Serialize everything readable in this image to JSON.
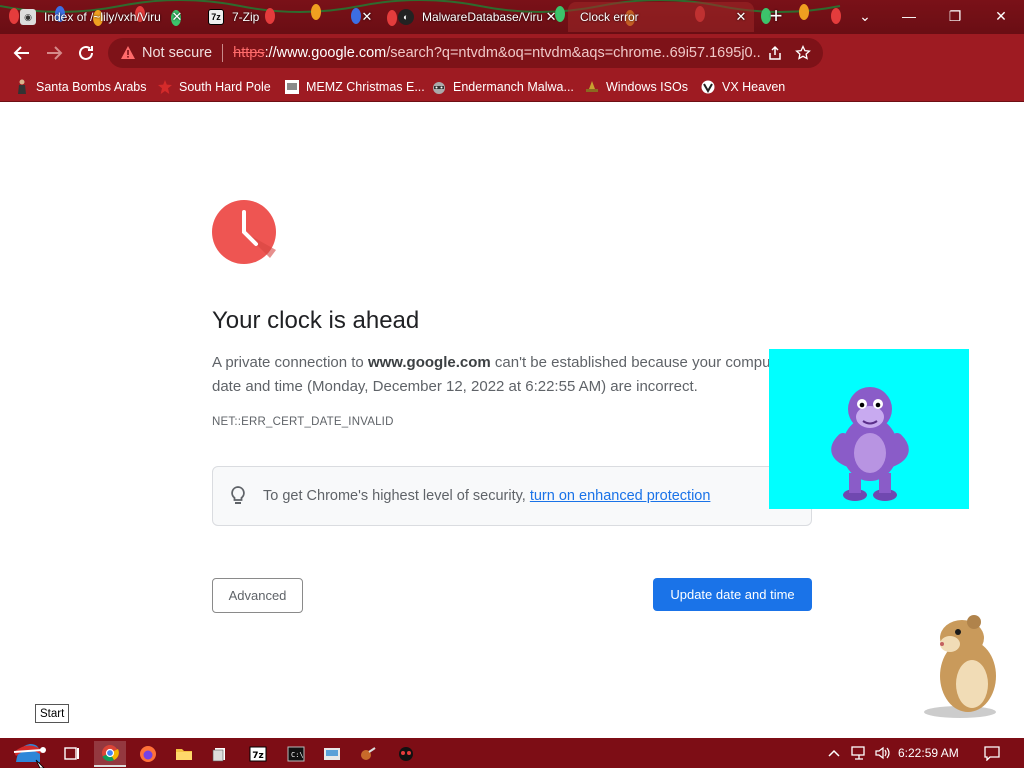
{
  "browser": {
    "tabs": [
      {
        "title": "Index of /~lily/vxh/Viru",
        "favicon": "web-icon"
      },
      {
        "title": "7-Zip",
        "favicon": "7zip-icon"
      },
      {
        "title": "MalwareDatabase/Viru",
        "favicon": "github-icon"
      },
      {
        "title": "Clock error",
        "favicon": "none",
        "active": true
      }
    ],
    "new_tab": "+",
    "window_controls": {
      "minimize": "—",
      "restore": "❐",
      "close": "✕",
      "chevron": "⌄"
    }
  },
  "toolbar": {
    "security_label": "Not secure",
    "url_scheme": "https",
    "url_host": "://www.google.com",
    "url_rest": "/search?q=ntvdm&oq=ntvdm&aqs=chrome..69i57.1695j0..."
  },
  "bookmarks": [
    {
      "label": "Santa Bombs Arabs",
      "icon": "figure-icon"
    },
    {
      "label": "South Hard Pole",
      "icon": "red-star-icon"
    },
    {
      "label": "MEMZ Christmas E...",
      "icon": "memz-icon"
    },
    {
      "label": "Endermanch Malwa...",
      "icon": "raccoon-icon"
    },
    {
      "label": "Windows ISOs",
      "icon": "hat-icon"
    },
    {
      "label": "VX Heaven",
      "icon": "vx-icon"
    }
  ],
  "page": {
    "heading": "Your clock is ahead",
    "para_prefix": "A private connection to ",
    "para_host": "www.google.com",
    "para_suffix": " can't be established because your computer's date and time (Monday, December 12, 2022 at 6:22:55 AM) are incorrect.",
    "error_code": "NET::ERR_CERT_DATE_INVALID",
    "security_tip": "To get Chrome's highest level of security, ",
    "security_link": "turn on enhanced protection",
    "advanced_button": "Advanced",
    "update_button": "Update date and time"
  },
  "start_tooltip": "Start",
  "taskbar": {
    "time": "6:22:59 AM",
    "items": [
      "start-icon",
      "task-view-icon",
      "chrome-icon",
      "firefox-icon",
      "file-explorer-icon",
      "files-icon",
      "7zip-icon",
      "cmd-icon",
      "app-icon",
      "tool-icon",
      "eyes-icon"
    ]
  },
  "colors": {
    "theme_red": "#9e1b22",
    "tabstrip": "#6a0e14",
    "clock_red": "#ee5552",
    "primary_blue": "#1a73e8",
    "bonzi_bg": "#00ffff"
  }
}
